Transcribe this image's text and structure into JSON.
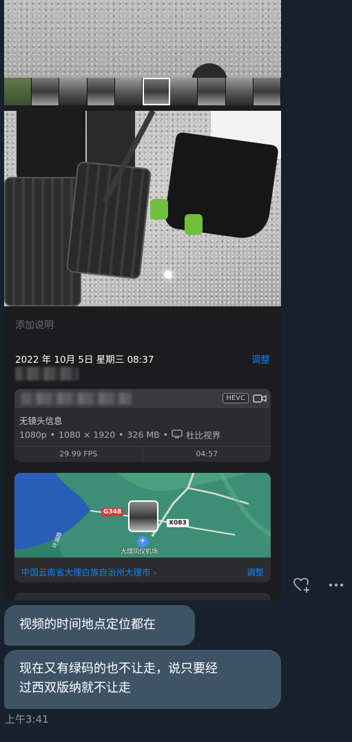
{
  "photo_card": {
    "caption_placeholder": "添加说明",
    "date_time": "2022 年 10月 5日  星期三  08:37",
    "adjust_label": "调整",
    "video_meta": {
      "codec_badge": "HEVC",
      "lens_info": "无镜头信息",
      "specs_resolution": "1080p",
      "specs_dims": "1080 × 1920",
      "specs_size": "326 MB",
      "specs_display": "杜比视界",
      "fps": "29.99 FPS",
      "duration": "04:57"
    },
    "map": {
      "road_red": "G348",
      "road_white": "X083",
      "airport_label": "大理凤仪机场",
      "vertical_road": "环湖路",
      "location": "中国云南省大理白族自治州大理市",
      "adjust_label": "调整"
    }
  },
  "actions": {
    "react_icon": "heart-plus-icon",
    "more_icon": "more-dots-icon"
  },
  "messages": [
    {
      "text": "视频的时间地点定位都在"
    },
    {
      "text_line1": "现在又有绿码的也不让走，说只要经",
      "text_line2": "过西双版纳就不让走"
    }
  ],
  "timestamp": "上午3:41",
  "colors": {
    "background": "#17212b",
    "bubble": "#3e5366",
    "link_blue": "#0a84ff",
    "map_green": "#3c8f74",
    "map_water": "#2a5fb8"
  }
}
